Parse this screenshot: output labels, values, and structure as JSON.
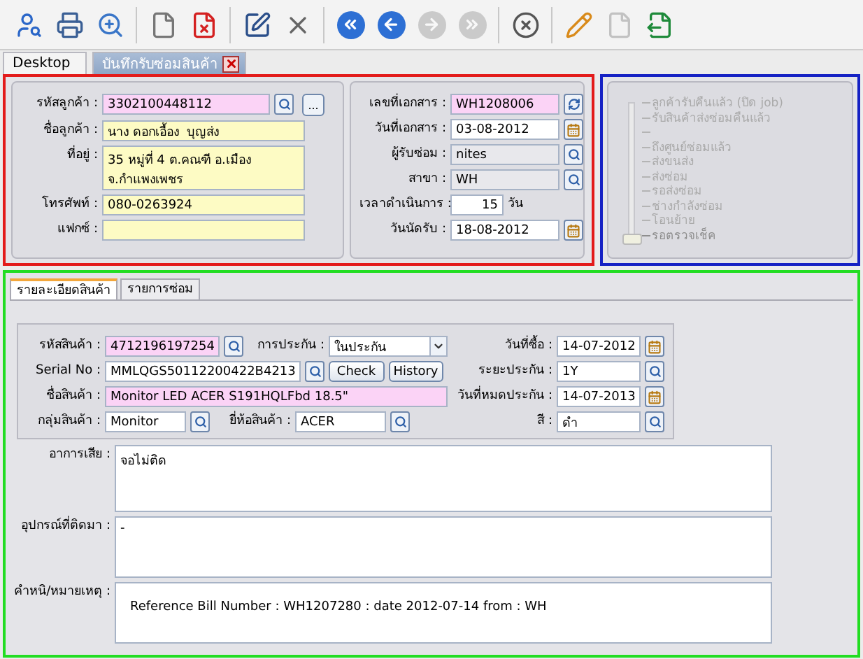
{
  "toolbar": [
    {
      "kind": "find-person",
      "disabled": false
    },
    {
      "kind": "print",
      "disabled": false
    },
    {
      "kind": "preview",
      "disabled": false
    },
    {
      "kind": "separator"
    },
    {
      "kind": "new",
      "disabled": false
    },
    {
      "kind": "delete",
      "disabled": false
    },
    {
      "kind": "separator"
    },
    {
      "kind": "edit",
      "disabled": false
    },
    {
      "kind": "cancel",
      "disabled": false
    },
    {
      "kind": "separator"
    },
    {
      "kind": "first",
      "disabled": false
    },
    {
      "kind": "previous",
      "disabled": false
    },
    {
      "kind": "next",
      "disabled": true
    },
    {
      "kind": "last",
      "disabled": true
    },
    {
      "kind": "separator"
    },
    {
      "kind": "close",
      "disabled": false
    },
    {
      "kind": "separator"
    },
    {
      "kind": "note",
      "disabled": false
    },
    {
      "kind": "blank",
      "disabled": true
    },
    {
      "kind": "export",
      "disabled": false
    }
  ],
  "tabs": [
    {
      "label": "Desktop",
      "selected": false,
      "closable": false
    },
    {
      "label": "บันทึกรับซ่อมสินค้า",
      "selected": true,
      "closable": true
    }
  ],
  "customer": [
    {
      "label": "รหัสลูกค้า :",
      "value": "3302100448112",
      "input": {
        "kind": "required"
      },
      "button": {
        "kind": "lookup"
      },
      "more": "..."
    },
    {
      "label": "ชื่อลูกค้า :",
      "value": "นาง ดอกเอื้อง  บุญส่ง",
      "input": {
        "kind": "info"
      }
    },
    {
      "label": "ที่อยู่ :",
      "value": "35 หมู่ที่ 4 ต.คณฑี อ.เมือง จ.กำแพงเพชร",
      "input": {
        "kind": "info"
      },
      "multiline": true
    },
    {
      "label": "โทรศัพท์ :",
      "value": "080-0263924",
      "input": {
        "kind": "info"
      }
    },
    {
      "label": "แฟกซ์ :",
      "input": {
        "kind": "info"
      }
    }
  ],
  "document": [
    {
      "label": "เลขที่เอกสาร :",
      "value": "WH1208006",
      "input": {
        "kind": "required"
      },
      "button": {
        "kind": "refresh"
      }
    },
    {
      "label": "วันที่เอกสาร :",
      "value": "03-08-2012",
      "input": {
        "kind": "plain"
      },
      "button": {
        "kind": "calendar"
      }
    },
    {
      "label": "ผู้รับซ่อม :",
      "value": "nites",
      "input": {
        "kind": "locked"
      },
      "button": {
        "kind": "lookup"
      }
    },
    {
      "label": "สาขา :",
      "value": "WH",
      "input": {
        "kind": "locked"
      },
      "button": {
        "kind": "lookup"
      }
    },
    {
      "label": "เวลาดำเนินการ :",
      "value": "15",
      "input": {
        "kind": "plain"
      },
      "unit": "วัน"
    },
    {
      "label": "วันนัดรับ :",
      "value": "18-08-2012",
      "input": {
        "kind": "plain"
      },
      "button": {
        "kind": "calendar"
      }
    }
  ],
  "status_steps": [
    {
      "label": "ลูกค้ารับคืนแล้ว (ปิด job)",
      "selected": false
    },
    {
      "label": "รับสินค้าส่งซ่อมคืนแล้ว",
      "selected": false
    },
    {
      "selected": false
    },
    {
      "label": "ถึงศูนย์ซ่อมแล้ว",
      "selected": false
    },
    {
      "label": "ส่งขนส่ง",
      "selected": false
    },
    {
      "label": "ส่งซ่อม",
      "selected": false
    },
    {
      "label": "รอส่งซ่อม",
      "selected": false
    },
    {
      "label": "ช่างกำลังซ่อม",
      "selected": false
    },
    {
      "label": "โอนย้าย",
      "selected": false
    },
    {
      "label": "รอตรวจเช็ค",
      "selected": true
    }
  ],
  "detail_tabs": [
    {
      "label": "รายละเอียดสินค้า",
      "selected": true
    },
    {
      "label": "รายการซ่อม",
      "selected": false
    }
  ],
  "product": {
    "rows": [
      [
        {
          "kind": "field",
          "label": "รหัสสินค้า :",
          "value": "4712196197254",
          "input": {
            "kind": "required"
          },
          "button": {
            "kind": "lookup"
          }
        },
        {
          "kind": "select",
          "label": "การประกัน :",
          "value": "ในประกัน"
        }
      ],
      [
        {
          "kind": "field",
          "label": "Serial No :",
          "value": "MMLQGS50112200422B4213",
          "input": {
            "kind": "plain"
          },
          "button": {
            "kind": "lookup"
          }
        },
        {
          "kind": "button",
          "label": "Check"
        },
        {
          "kind": "button",
          "label": "History"
        }
      ],
      [
        {
          "kind": "field",
          "label": "ชื่อสินค้า :",
          "value": "Monitor LED ACER S191HQLFbd 18.5\"",
          "input": {
            "kind": "required"
          }
        }
      ],
      [
        {
          "kind": "field",
          "label": "กลุ่มสินค้า :",
          "value": "Monitor",
          "input": {
            "kind": "plain"
          },
          "button": {
            "kind": "lookup"
          }
        },
        {
          "kind": "field",
          "label": "ยี่ห้อสินค้า :",
          "value": "ACER",
          "input": {
            "kind": "plain"
          },
          "button": {
            "kind": "lookup"
          }
        }
      ]
    ],
    "side": [
      {
        "label": "วันที่ซื้อ :",
        "value": "14-07-2012",
        "input": {
          "kind": "plain"
        },
        "button": {
          "kind": "calendar"
        }
      },
      {
        "label": "ระยะประกัน :",
        "value": "1Y",
        "input": {
          "kind": "plain"
        },
        "button": {
          "kind": "lookup"
        }
      },
      {
        "label": "วันที่หมดประกัน :",
        "value": "14-07-2013",
        "input": {
          "kind": "plain"
        },
        "button": {
          "kind": "calendar"
        }
      },
      {
        "label": "สี :",
        "value": "ดำ",
        "input": {
          "kind": "plain"
        },
        "button": {
          "kind": "lookup"
        }
      }
    ]
  },
  "notes": [
    {
      "label": "อาการเสีย :",
      "value": "จอไม่ติด"
    },
    {
      "label": "อุปกรณ์ที่ติดมา :",
      "value": "-"
    },
    {
      "label": "คำหนิ/หมายเหตุ :",
      "value": "Reference Bill Number : WH1207280 : date 2012-07-14 from : WH"
    }
  ]
}
